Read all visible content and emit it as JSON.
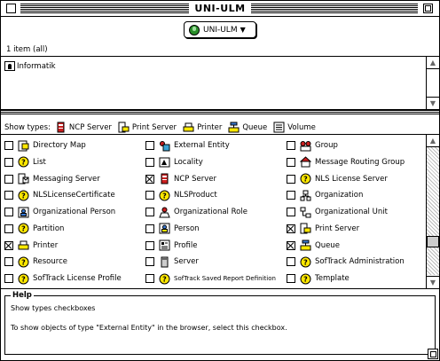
{
  "window": {
    "title": "UNI-ULM"
  },
  "popup": {
    "label": "UNI-ULM",
    "arrow": "▼"
  },
  "status": {
    "item_count": "1 item (all)"
  },
  "browser": {
    "items": [
      {
        "label": "Informatik"
      }
    ]
  },
  "show_types": {
    "label": "Show types:",
    "legend": [
      {
        "label": "NCP Server",
        "icon": "ncp-server-icon"
      },
      {
        "label": "Print Server",
        "icon": "print-server-icon"
      },
      {
        "label": "Printer",
        "icon": "printer-icon"
      },
      {
        "label": "Queue",
        "icon": "queue-icon"
      },
      {
        "label": "Volume",
        "icon": "volume-icon"
      }
    ]
  },
  "types": [
    {
      "label": "Directory Map",
      "icon": "directory-map-icon",
      "checked": false
    },
    {
      "label": "External Entity",
      "icon": "external-entity-icon",
      "checked": false
    },
    {
      "label": "Group",
      "icon": "group-icon",
      "checked": false
    },
    {
      "label": "List",
      "icon": "question-icon",
      "checked": false
    },
    {
      "label": "Locality",
      "icon": "locality-icon",
      "checked": false
    },
    {
      "label": "Message Routing Group",
      "icon": "message-routing-group-icon",
      "checked": false
    },
    {
      "label": "Messaging Server",
      "icon": "messaging-server-icon",
      "checked": false
    },
    {
      "label": "NCP Server",
      "icon": "ncp-server-icon",
      "checked": true
    },
    {
      "label": "NLS License Server",
      "icon": "question-icon",
      "checked": false
    },
    {
      "label": "NLSLicenseCertificate",
      "icon": "question-icon",
      "checked": false
    },
    {
      "label": "NLSProduct",
      "icon": "question-icon",
      "checked": false
    },
    {
      "label": "Organization",
      "icon": "organization-icon",
      "checked": false
    },
    {
      "label": "Organizational Person",
      "icon": "organizational-person-icon",
      "checked": false
    },
    {
      "label": "Organizational Role",
      "icon": "organizational-role-icon",
      "checked": false
    },
    {
      "label": "Organizational Unit",
      "icon": "organizational-unit-icon",
      "checked": false
    },
    {
      "label": "Partition",
      "icon": "question-icon",
      "checked": false
    },
    {
      "label": "Person",
      "icon": "person-icon",
      "checked": false
    },
    {
      "label": "Print Server",
      "icon": "print-server-icon",
      "checked": true
    },
    {
      "label": "Printer",
      "icon": "printer-icon",
      "checked": true
    },
    {
      "label": "Profile",
      "icon": "profile-icon",
      "checked": false
    },
    {
      "label": "Queue",
      "icon": "queue-icon",
      "checked": true
    },
    {
      "label": "Resource",
      "icon": "question-icon",
      "checked": false
    },
    {
      "label": "Server",
      "icon": "server-icon",
      "checked": false
    },
    {
      "label": "SofTrack Administration",
      "icon": "question-icon",
      "checked": false
    },
    {
      "label": "SofTrack License Profile",
      "icon": "question-icon",
      "checked": false
    },
    {
      "label": "SofTrack Saved Report Definition",
      "icon": "question-icon",
      "checked": false
    },
    {
      "label": "Template",
      "icon": "question-icon",
      "checked": false
    }
  ],
  "help": {
    "title": "Help",
    "line1": "Show types checkboxes",
    "line2": "To show objects of type \"External Entity\" in the browser, select this checkbox."
  },
  "colors": {
    "question_yellow": "#ffe800",
    "ncp_red": "#cc1f1f",
    "globe_green": "#2a8f2a"
  }
}
